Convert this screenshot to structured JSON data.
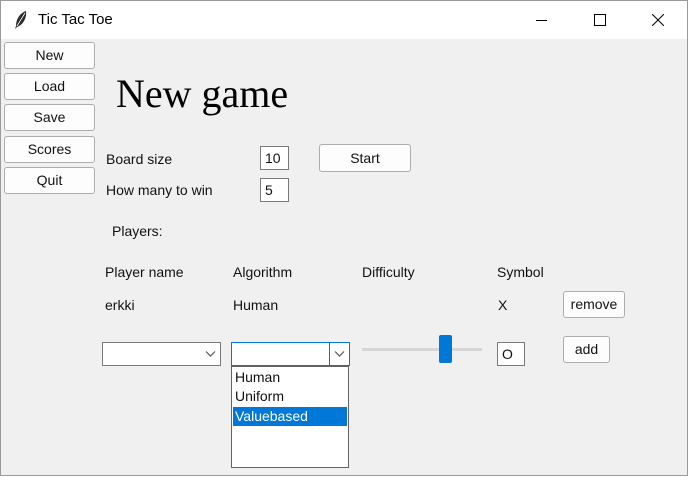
{
  "window": {
    "title": "Tic Tac Toe"
  },
  "sidebar": {
    "items": [
      {
        "label": "New"
      },
      {
        "label": "Load"
      },
      {
        "label": "Save"
      },
      {
        "label": "Scores"
      },
      {
        "label": "Quit"
      }
    ]
  },
  "main": {
    "heading": "New game",
    "board_size": {
      "label": "Board size",
      "value": "10"
    },
    "win_count": {
      "label": "How many to win",
      "value": "5"
    },
    "start_label": "Start",
    "players_label": "Players:",
    "columns": [
      "Player name",
      "Algorithm",
      "Difficulty",
      "Symbol"
    ],
    "players": [
      {
        "name": "erkki",
        "algorithm": "Human",
        "symbol": "X",
        "remove_label": "remove"
      }
    ],
    "new_player": {
      "name_value": "",
      "algorithm_value": "",
      "difficulty_level": 0.72,
      "symbol_value": "O",
      "add_label": "add"
    },
    "algorithm_dropdown": {
      "options": [
        "Human",
        "Uniform",
        "Valuebased"
      ],
      "highlighted": "Valuebased"
    }
  },
  "colors": {
    "accent": "#0078d7",
    "window_bg": "#f0f0f0",
    "titlebar_bg": "#ffffff"
  },
  "icons": {
    "app": "feather-icon",
    "minimize": "minimize-icon",
    "maximize": "maximize-icon",
    "close": "close-icon"
  }
}
